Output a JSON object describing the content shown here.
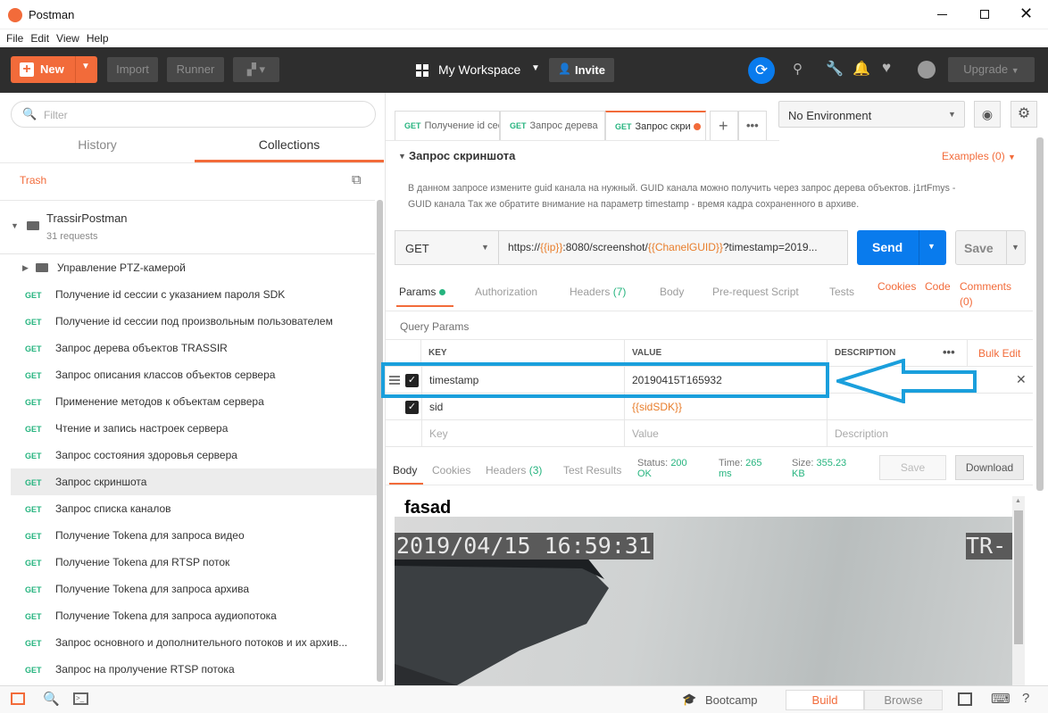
{
  "window": {
    "title": "Postman"
  },
  "menu": [
    "File",
    "Edit",
    "View",
    "Help"
  ],
  "header": {
    "new_label": "New",
    "import_label": "Import",
    "runner_label": "Runner",
    "workspace_label": "My Workspace",
    "invite_label": "Invite",
    "upgrade_label": "Upgrade"
  },
  "sidebar": {
    "filter_placeholder": "Filter",
    "tabs": [
      "History",
      "Collections"
    ],
    "trash_label": "Trash",
    "collection": {
      "name": "TrassirPostman",
      "count": "31 requests"
    },
    "folder": "Управление PTZ-камерой",
    "method": "GET",
    "requests": [
      "Получение id сессии с указанием пароля SDK",
      "Получение id сессии под произвольным пользователем",
      "Запрос дерева объектов TRASSIR",
      "Запрос описания классов объектов сервера",
      "Применение методов к объектам сервера",
      "Чтение и запись настроек сервера",
      "Запрос состояния здоровья сервера",
      "Запрос скриншота",
      "Запрос списка каналов",
      "Получение Tokena для запроса видео",
      "Получение Tokena для RTSP поток",
      "Получение Tokena для запроса архива",
      "Получение Tokena для запроса аудиопотока",
      "Запрос основного и дополнительного потоков и их архив...",
      "Запрос на пролучение RTSP потока"
    ]
  },
  "tabs": [
    {
      "method": "GET",
      "label": "Получение id сессии"
    },
    {
      "method": "GET",
      "label": "Запрос дерева"
    },
    {
      "method": "GET",
      "label": "Запрос скри"
    }
  ],
  "environment": {
    "selected": "No Environment"
  },
  "request": {
    "name": "Запрос скриншота",
    "examples_label": "Examples (0)",
    "description_line1": "В данном запросе измените guid канала на нужный. GUID канала можно получить через запрос дерева объектов. j1rtFmys -",
    "description_line2": "GUID канала Так же обратите внимание на параметр timestamp - время кадра сохраненного в архиве.",
    "method": "GET",
    "url_prefix": "https://",
    "url_var1": "{{ip}}",
    "url_mid": ":8080/screenshot/",
    "url_var2": "{{ChanelGUID}}",
    "url_suffix": "?timestamp=2019...",
    "send_label": "Send",
    "save_label": "Save"
  },
  "request_tabs": {
    "params": "Params",
    "authorization": "Authorization",
    "headers": "Headers",
    "headers_count": "(7)",
    "body": "Body",
    "prerequest": "Pre-request Script",
    "tests": "Tests",
    "cookies": "Cookies",
    "code": "Code",
    "comments": "Comments",
    "comments_count": "(0)"
  },
  "query_params": {
    "title": "Query Params",
    "col_key": "KEY",
    "col_value": "VALUE",
    "col_description": "DESCRIPTION",
    "bulk_edit": "Bulk Edit",
    "rows": [
      {
        "key": "timestamp",
        "value": "20190415T165932",
        "checked": true
      },
      {
        "key": "sid",
        "value": "{{sidSDK}}",
        "checked": true
      }
    ],
    "placeholder_key": "Key",
    "placeholder_value": "Value",
    "placeholder_description": "Description"
  },
  "response": {
    "body": "Body",
    "cookies": "Cookies",
    "headers": "Headers",
    "headers_count": "(3)",
    "test_results": "Test Results",
    "status_label": "Status:",
    "status_value": "200",
    "status_text": "OK",
    "time_label": "Time:",
    "time_value": "265",
    "time_unit": "ms",
    "size_label": "Size:",
    "size_value": "355.23",
    "size_unit": "KB",
    "save_label": "Save",
    "download_label": "Download",
    "image_caption": "fasad",
    "overlay_date": "2019/04/15 16:59:31",
    "overlay_tag": "TR-"
  },
  "bottom": {
    "bootcamp": "Bootcamp",
    "build": "Build",
    "browse": "Browse"
  },
  "colors": {
    "accent": "#f26b3a",
    "send": "#097bed",
    "sync": "#097bed",
    "highlight": "#1a9fdc",
    "header_bg": "#2e2e2e",
    "var_orange": "#e87d2b"
  }
}
